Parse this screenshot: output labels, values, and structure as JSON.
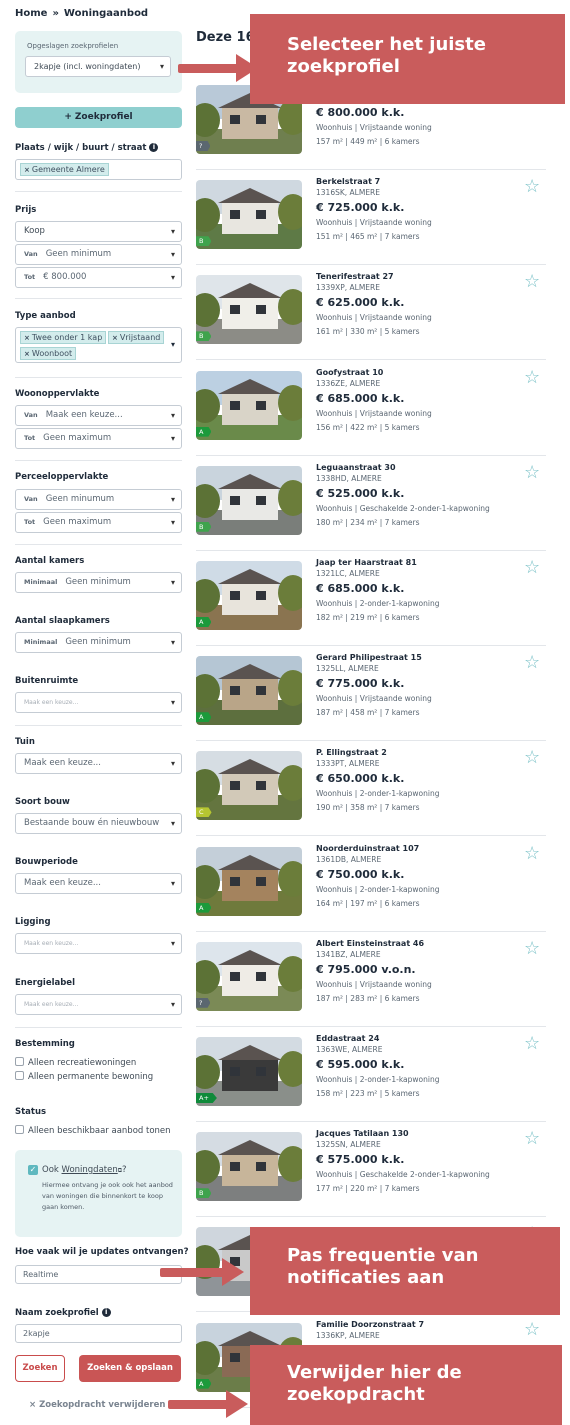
{
  "breadcrumb": {
    "home": "Home",
    "sep": "»",
    "current": "Woningaanbod"
  },
  "saved_profiles": {
    "label": "Opgeslagen zoekprofielen",
    "selected": "2kapje (incl. woningdaten)"
  },
  "new_profile_button": "Zoekprofiel",
  "location": {
    "label": "Plaats / wijk / buurt / straat",
    "tag": "Gemeente Almere"
  },
  "price": {
    "label": "Prijs",
    "type": "Koop",
    "from_prefix": "Van",
    "from_value": "Geen minimum",
    "to_prefix": "Tot",
    "to_value": "€ 800.000"
  },
  "type_aanbod": {
    "label": "Type aanbod",
    "tags": [
      "Twee onder 1 kap",
      "Vrijstaand",
      "Woonboot"
    ]
  },
  "woonoppervlakte": {
    "label": "Woonoppervlakte",
    "from_prefix": "Van",
    "from_value": "Maak een keuze...",
    "to_prefix": "Tot",
    "to_value": "Geen maximum"
  },
  "perceeloppervlakte": {
    "label": "Perceeloppervlakte",
    "from_prefix": "Van",
    "from_value": "Geen minumum",
    "to_prefix": "Tot",
    "to_value": "Geen maximum"
  },
  "aantal_kamers": {
    "label": "Aantal kamers",
    "prefix": "Minimaal",
    "value": "Geen minimum"
  },
  "aantal_slaapkamers": {
    "label": "Aantal slaapkamers",
    "prefix": "Minimaal",
    "value": "Geen minimum"
  },
  "buitenruimte": {
    "label": "Buitenruimte",
    "placeholder": "Maak een keuze..."
  },
  "tuin": {
    "label": "Tuin",
    "value": "Maak een keuze..."
  },
  "soort_bouw": {
    "label": "Soort bouw",
    "value": "Bestaande bouw én nieuwbouw"
  },
  "bouwperiode": {
    "label": "Bouwperiode",
    "value": "Maak een keuze..."
  },
  "ligging": {
    "label": "Ligging",
    "placeholder": "Maak een keuze..."
  },
  "energielabel": {
    "label": "Energielabel",
    "placeholder": "Maak een keuze..."
  },
  "bestemming": {
    "label": "Bestemming",
    "options": [
      "Alleen recreatiewoningen",
      "Alleen permanente bewoning"
    ]
  },
  "status": {
    "label": "Status",
    "option": "Alleen beschikbaar aanbod tonen"
  },
  "notify_box": {
    "prefix": "Ook",
    "link": "Woningdaten",
    "suffix": "?",
    "text": "Hiermee ontvang je ook ook het aanbod van woningen die binnenkort te koop gaan komen."
  },
  "updates": {
    "label": "Hoe vaak wil je updates ontvangen?",
    "value": "Realtime"
  },
  "profile_name": {
    "label": "Naam zoekprofiel",
    "value": "2kapje"
  },
  "buttons": {
    "search": "Zoeken",
    "search_save": "Zoeken & opslaan",
    "delete": "Zoekopdracht verwijderen"
  },
  "results": {
    "count_text": "Deze 162",
    "items": [
      {
        "address": "",
        "postcode": "",
        "price": "€ 800.000 k.k.",
        "kind": "Woonhuis | Vrijstaande woning",
        "meas": "157 m² | 449 m² | 6 kamers",
        "label": "?",
        "label_color": "#5b6770"
      },
      {
        "address": "Berkelstraat 7",
        "postcode": "1316SK, ALMERE",
        "price": "€ 725.000 k.k.",
        "kind": "Woonhuis | Vrijstaande woning",
        "meas": "151 m² | 465 m² | 7 kamers",
        "label": "B",
        "label_color": "#3fa34d"
      },
      {
        "address": "Tenerifestraat 27",
        "postcode": "1339XP, ALMERE",
        "price": "€ 625.000 k.k.",
        "kind": "Woonhuis | Vrijstaande woning",
        "meas": "161 m² | 330 m² | 5 kamers",
        "label": "B",
        "label_color": "#3fa34d"
      },
      {
        "address": "Goofystraat 10",
        "postcode": "1336ZE, ALMERE",
        "price": "€ 685.000 k.k.",
        "kind": "Woonhuis | Vrijstaande woning",
        "meas": "156 m² | 422 m² | 5 kamers",
        "label": "A",
        "label_color": "#1c9a3b"
      },
      {
        "address": "Leguaanstraat 30",
        "postcode": "1338HD, ALMERE",
        "price": "€ 525.000 k.k.",
        "kind": "Woonhuis | Geschakelde 2-onder-1-kapwoning",
        "meas": "180 m² | 234 m² | 7 kamers",
        "label": "B",
        "label_color": "#3fa34d"
      },
      {
        "address": "Jaap ter Haarstraat 81",
        "postcode": "1321LC, ALMERE",
        "price": "€ 685.000 k.k.",
        "kind": "Woonhuis | 2-onder-1-kapwoning",
        "meas": "182 m² | 219 m² | 6 kamers",
        "label": "A",
        "label_color": "#1c9a3b"
      },
      {
        "address": "Gerard Philipestraat 15",
        "postcode": "1325LL, ALMERE",
        "price": "€ 775.000 k.k.",
        "kind": "Woonhuis | Vrijstaande woning",
        "meas": "187 m² | 458 m² | 7 kamers",
        "label": "A",
        "label_color": "#1c9a3b"
      },
      {
        "address": "P. Ellingstraat 2",
        "postcode": "1333PT, ALMERE",
        "price": "€ 650.000 k.k.",
        "kind": "Woonhuis | 2-onder-1-kapwoning",
        "meas": "190 m² | 358 m² | 7 kamers",
        "label": "C",
        "label_color": "#b6c631"
      },
      {
        "address": "Noorderduinstraat 107",
        "postcode": "1361DB, ALMERE",
        "price": "€ 750.000 k.k.",
        "kind": "Woonhuis | 2-onder-1-kapwoning",
        "meas": "164 m² | 197 m² | 6 kamers",
        "label": "A",
        "label_color": "#1c9a3b"
      },
      {
        "address": "Albert Einsteinstraat 46",
        "postcode": "1341BZ, ALMERE",
        "price": "€ 795.000 v.o.n.",
        "kind": "Woonhuis | Vrijstaande woning",
        "meas": "187 m² | 283 m² | 6 kamers",
        "label": "?",
        "label_color": "#5b6770"
      },
      {
        "address": "Eddastraat 24",
        "postcode": "1363WE, ALMERE",
        "price": "€ 595.000 k.k.",
        "kind": "Woonhuis | 2-onder-1-kapwoning",
        "meas": "158 m² | 223 m² | 5 kamers",
        "label": "A+",
        "label_color": "#0f8a3a"
      },
      {
        "address": "Jacques Tatilaan 130",
        "postcode": "1325SN, ALMERE",
        "price": "€ 575.000 k.k.",
        "kind": "Woonhuis | Geschakelde 2-onder-1-kapwoning",
        "meas": "177 m² | 220 m² | 7 kamers",
        "label": "B",
        "label_color": "#3fa34d"
      },
      {
        "address": "",
        "postcode": "",
        "price": "",
        "kind": "",
        "meas": "",
        "label": "",
        "label_color": "#3fa34d"
      },
      {
        "address": "Familie Doorzonstraat 7",
        "postcode": "1336KP, ALMERE",
        "price": "",
        "kind": "",
        "meas": "",
        "label": "A",
        "label_color": "#1c9a3b"
      }
    ]
  },
  "annotations": {
    "profile": "Selecteer het juiste zoekprofiel",
    "frequency": "Pas frequentie van notificaties aan",
    "delete": "Verwijder hier de zoekopdracht"
  },
  "colors": {
    "teal": "#8fcfcf",
    "accent_red": "#c95555",
    "banner": "#c95c5c"
  }
}
